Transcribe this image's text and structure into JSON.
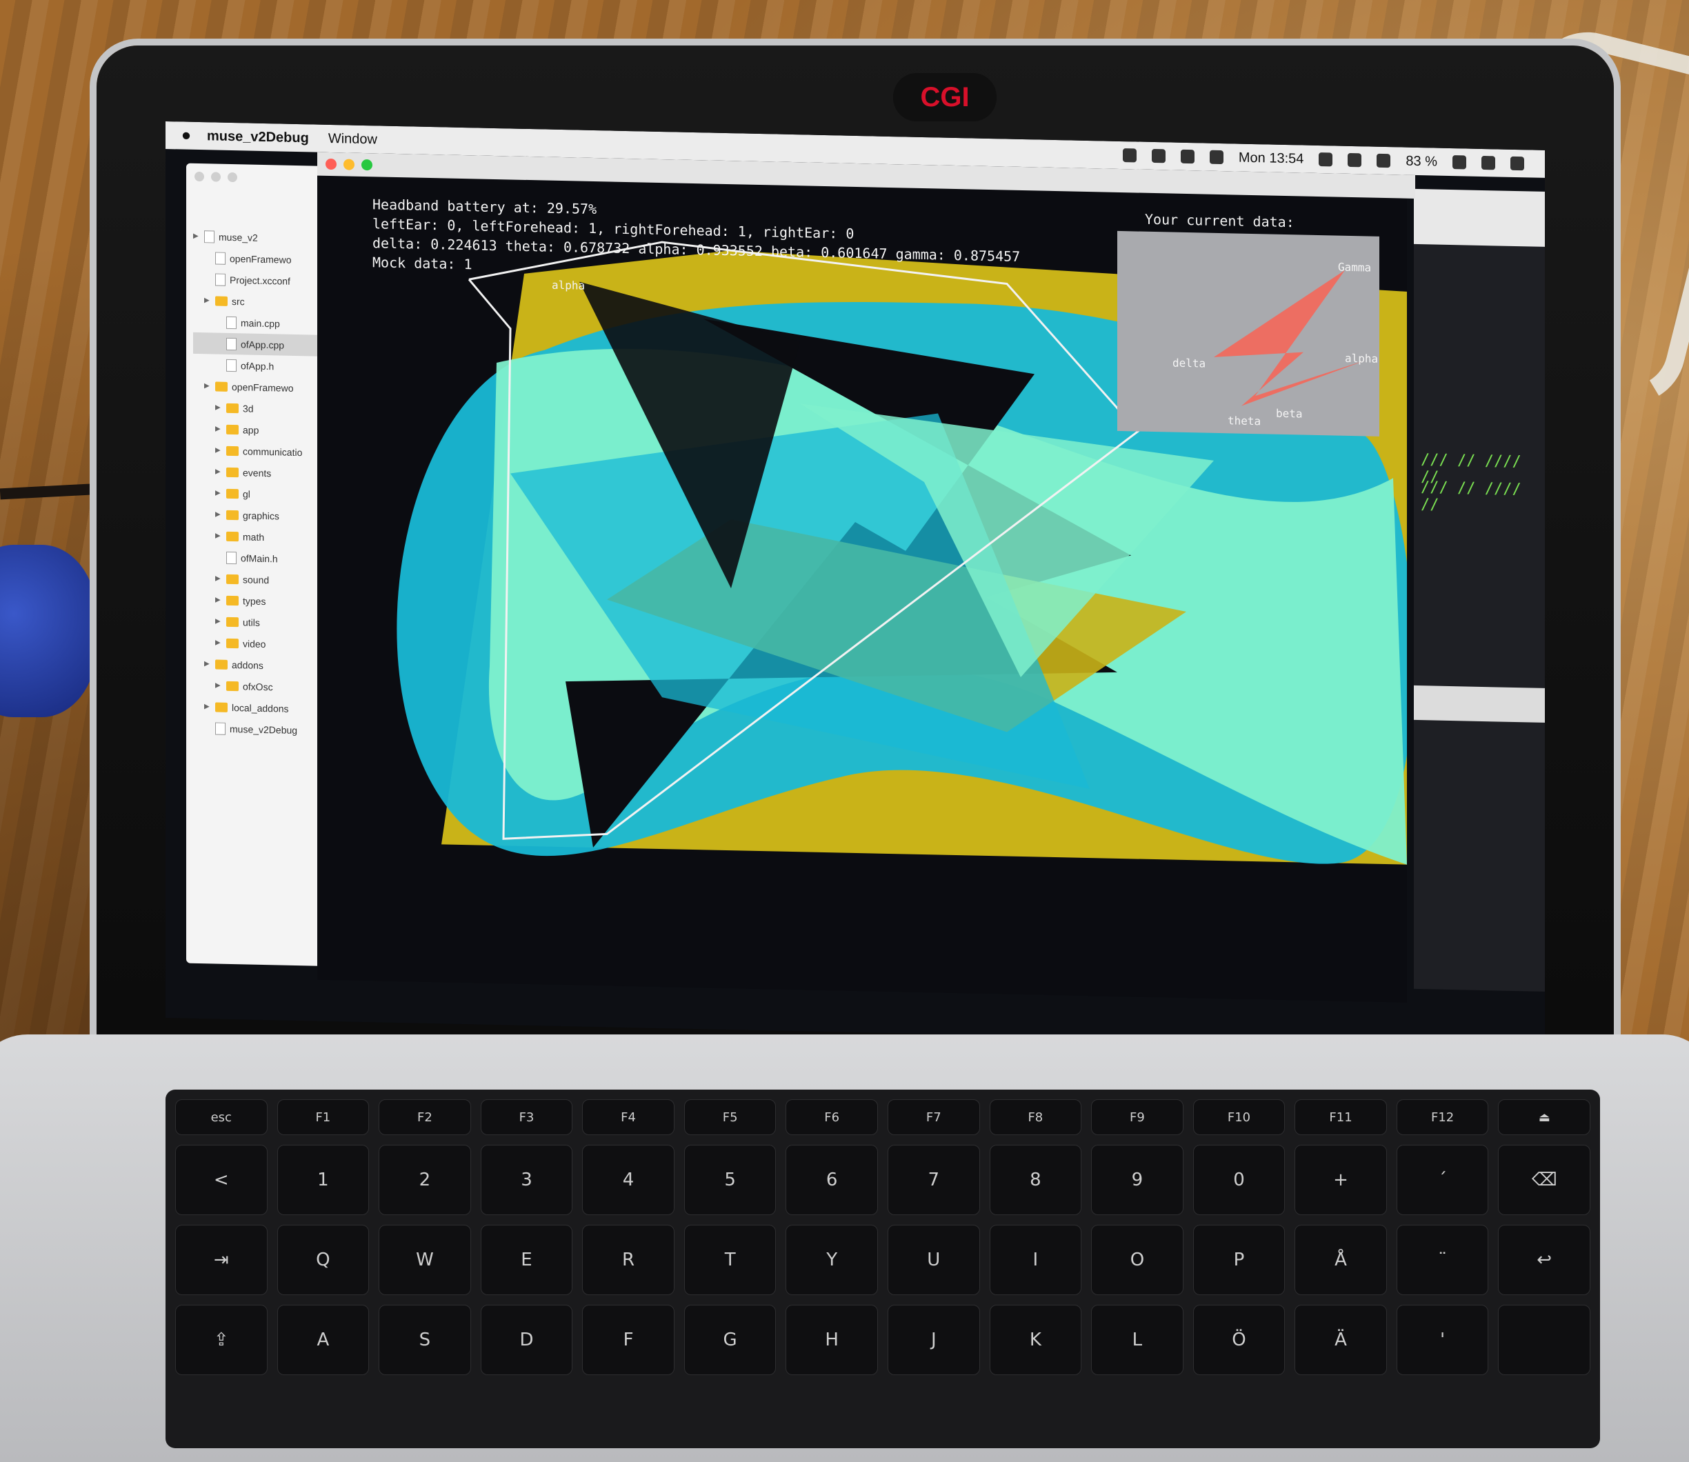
{
  "webcam_cover": {
    "label": "CGI"
  },
  "menubar": {
    "apple": "",
    "app_name": "muse_v2Debug",
    "menu_window": "Window",
    "clock": "Mon 13:54",
    "battery": "83 %"
  },
  "sidebar": {
    "items": [
      {
        "label": "muse_v2",
        "kind": "project",
        "level": 0
      },
      {
        "label": "openFramewo",
        "kind": "file",
        "level": 1
      },
      {
        "label": "Project.xcconf",
        "kind": "file",
        "level": 1
      },
      {
        "label": "src",
        "kind": "folder",
        "level": 1
      },
      {
        "label": "main.cpp",
        "kind": "file",
        "level": 2
      },
      {
        "label": "ofApp.cpp",
        "kind": "file",
        "level": 2,
        "selected": true
      },
      {
        "label": "ofApp.h",
        "kind": "file",
        "level": 2
      },
      {
        "label": "openFramewo",
        "kind": "folder",
        "level": 1
      },
      {
        "label": "3d",
        "kind": "folder",
        "level": 2
      },
      {
        "label": "app",
        "kind": "folder",
        "level": 2
      },
      {
        "label": "communicatio",
        "kind": "folder",
        "level": 2
      },
      {
        "label": "events",
        "kind": "folder",
        "level": 2
      },
      {
        "label": "gl",
        "kind": "folder",
        "level": 2
      },
      {
        "label": "graphics",
        "kind": "folder",
        "level": 2
      },
      {
        "label": "math",
        "kind": "folder",
        "level": 2
      },
      {
        "label": "ofMain.h",
        "kind": "file",
        "level": 2
      },
      {
        "label": "sound",
        "kind": "folder",
        "level": 2
      },
      {
        "label": "types",
        "kind": "folder",
        "level": 2
      },
      {
        "label": "utils",
        "kind": "folder",
        "level": 2
      },
      {
        "label": "video",
        "kind": "folder",
        "level": 2
      },
      {
        "label": "addons",
        "kind": "folder",
        "level": 1
      },
      {
        "label": "ofxOsc",
        "kind": "folder",
        "level": 2
      },
      {
        "label": "local_addons",
        "kind": "folder",
        "level": 1
      },
      {
        "label": "muse_v2Debug",
        "kind": "file",
        "level": 1
      }
    ]
  },
  "app": {
    "stats": [
      "Headband battery at: 29.57%",
      "leftEar: 0, leftForehead: 1, rightForehead: 1, rightEar: 0",
      "delta: 0.224613  theta: 0.678732  alpha: 0.933552  beta: 0.601647  gamma: 0.875457",
      "Mock data: 1"
    ],
    "current_data_label": "Your current data:",
    "art_label": "alpha"
  },
  "radar": {
    "labels": {
      "gamma": "Gamma",
      "alpha": "alpha",
      "delta": "delta",
      "beta": "beta",
      "theta": "theta"
    }
  },
  "colors": {
    "yellow": "#c9b318",
    "cyan": "#19b9d6",
    "mint": "#7ff0cc",
    "radar_fill": "#f06a5e",
    "radar_bg": "#a9aaae"
  },
  "keyboard": {
    "fn_row": [
      "esc",
      "F1",
      "F2",
      "F3",
      "F4",
      "F5",
      "F6",
      "F7",
      "F8",
      "F9",
      "F10",
      "F11",
      "F12",
      "⏏"
    ],
    "rows": [
      [
        "<",
        "1",
        "2",
        "3",
        "4",
        "5",
        "6",
        "7",
        "8",
        "9",
        "0",
        "+",
        "´",
        "⌫"
      ],
      [
        "⇥",
        "Q",
        "W",
        "E",
        "R",
        "T",
        "Y",
        "U",
        "I",
        "O",
        "P",
        "Å",
        "¨",
        "↩"
      ],
      [
        "⇪",
        "A",
        "S",
        "D",
        "F",
        "G",
        "H",
        "J",
        "K",
        "L",
        "Ö",
        "Ä",
        "'",
        ""
      ]
    ]
  }
}
